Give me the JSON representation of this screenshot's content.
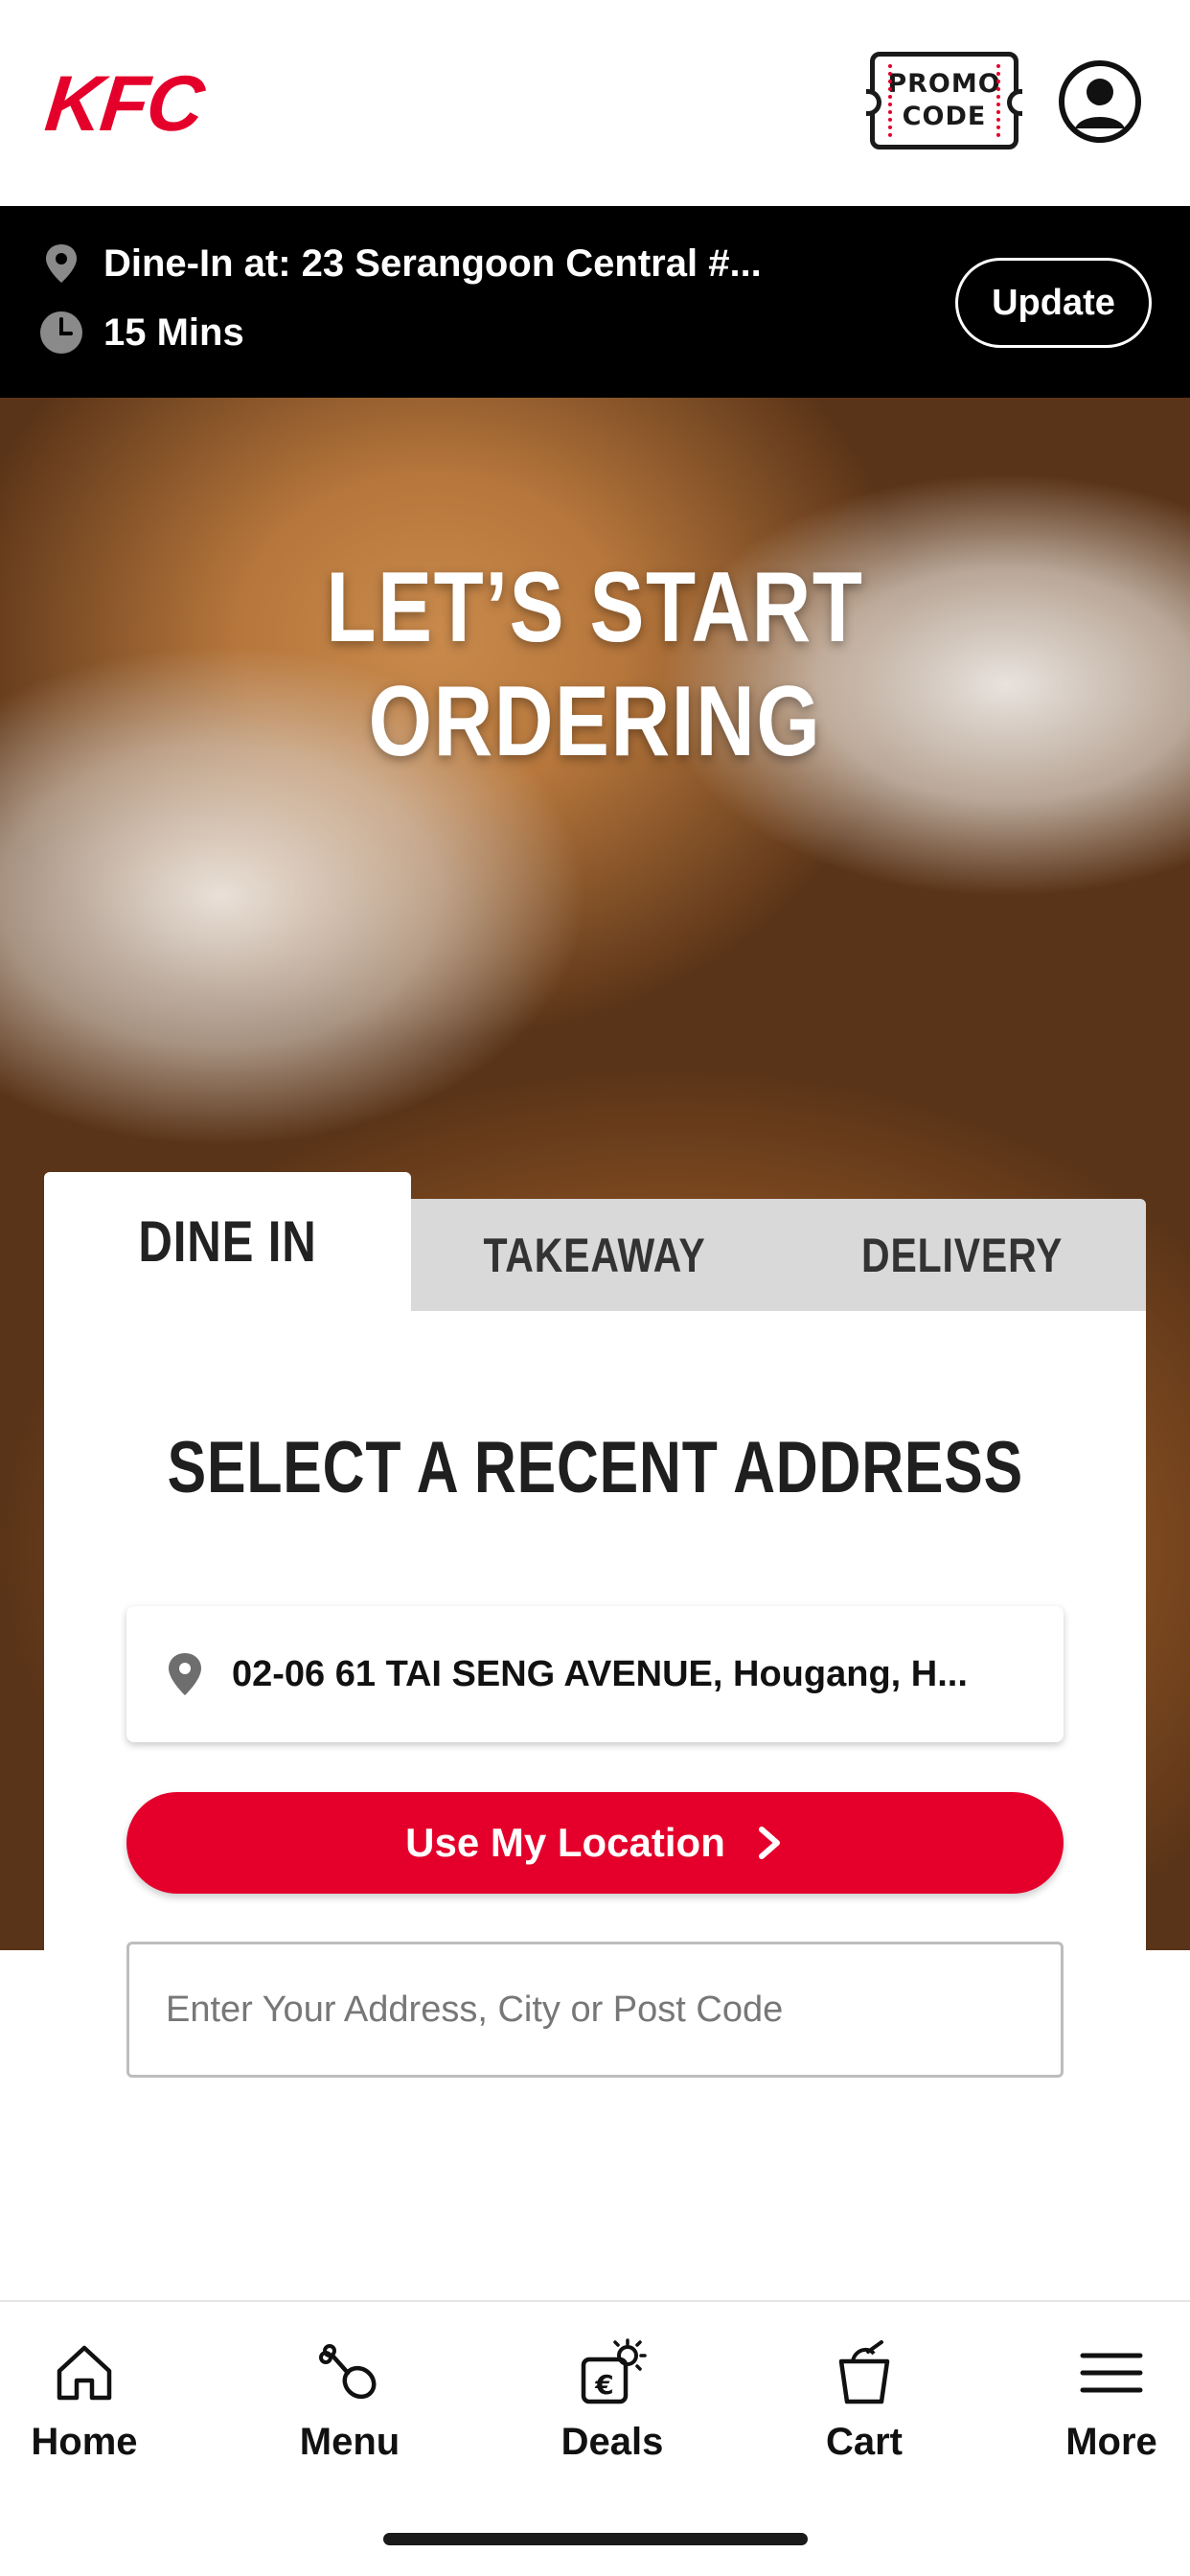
{
  "header": {
    "logo": "KFC",
    "promo_line1": "PROMO",
    "promo_line2": "CODE"
  },
  "order_info": {
    "location": "Dine-In at: 23 Serangoon Central #...",
    "wait_time": "15 Mins",
    "update_label": "Update"
  },
  "hero": {
    "title": "LET’S START ORDERING"
  },
  "tabs": [
    {
      "label": "DINE IN",
      "active": true
    },
    {
      "label": "TAKEAWAY",
      "active": false
    },
    {
      "label": "DELIVERY",
      "active": false
    }
  ],
  "card": {
    "title": "SELECT A RECENT ADDRESS",
    "recent_address": "02-06 61 TAI SENG AVENUE, Hougang, H...",
    "use_location_label": "Use My Location",
    "address_placeholder": "Enter Your Address, City or Post Code",
    "address_value": ""
  },
  "bottom_nav": [
    {
      "label": "Home",
      "icon": "home-icon"
    },
    {
      "label": "Menu",
      "icon": "drumstick-icon"
    },
    {
      "label": "Deals",
      "icon": "deals-icon"
    },
    {
      "label": "Cart",
      "icon": "bucket-icon"
    },
    {
      "label": "More",
      "icon": "hamburger-icon"
    }
  ],
  "colors": {
    "brand_red": "#e4002b",
    "bar_black": "#000000",
    "tab_inactive": "#d9d9d9"
  }
}
